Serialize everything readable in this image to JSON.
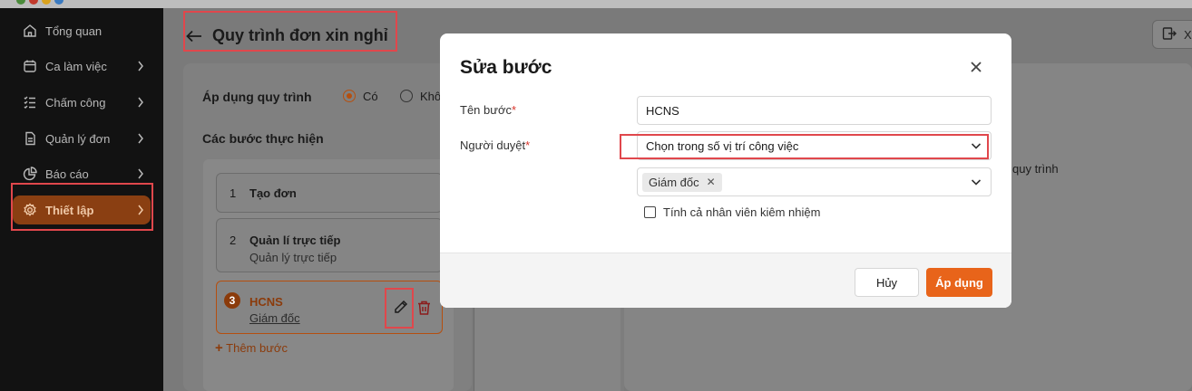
{
  "sidebar": {
    "items": [
      {
        "label": "Tổng quan",
        "icon": "home-icon",
        "has_chevron": false
      },
      {
        "label": "Ca làm việc",
        "icon": "calendar-icon",
        "has_chevron": true
      },
      {
        "label": "Chấm công",
        "icon": "checklist-icon",
        "has_chevron": true
      },
      {
        "label": "Quản lý đơn",
        "icon": "document-icon",
        "has_chevron": true
      },
      {
        "label": "Báo cáo",
        "icon": "pie-chart-icon",
        "has_chevron": true
      },
      {
        "label": "Thiết lập",
        "icon": "gear-icon",
        "has_chevron": true,
        "active": true
      }
    ]
  },
  "header": {
    "title": "Quy trình đơn xin nghỉ",
    "export_label": "X"
  },
  "workflow": {
    "apply_label": "Áp dụng quy trình",
    "options": [
      "Có",
      "Khô"
    ],
    "selected": "Có",
    "steps_label": "Các bước thực hiện",
    "steps": [
      {
        "num": "1",
        "name": "Tạo đơn",
        "sub": ""
      },
      {
        "num": "2",
        "name": "Quản lí trực tiếp",
        "sub": "Quản lý trực tiếp"
      },
      {
        "num": "3",
        "name": "HCNS",
        "sub": "Giám đốc"
      }
    ],
    "add_step_label": "Thêm bước",
    "right_text": "quy trình"
  },
  "modal": {
    "title": "Sửa bước",
    "step_name_label": "Tên bước",
    "step_name_value": "HCNS",
    "approver_label": "Người duyệt",
    "approver_mode": "Chọn trong số vị trí công việc",
    "approver_tags": [
      "Giám đốc"
    ],
    "include_concurrent_label": "Tính cả nhân viên kiêm nhiệm",
    "include_concurrent_checked": false,
    "cancel_label": "Hủy",
    "apply_label": "Áp dụng"
  },
  "colors": {
    "accent": "#e8641a",
    "highlight": "#e0474c",
    "sidebar_bg": "#121212"
  }
}
